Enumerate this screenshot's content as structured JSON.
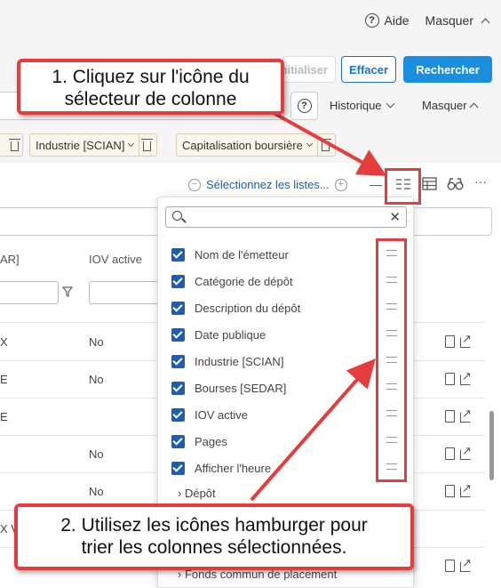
{
  "header": {
    "help_label": "Aide",
    "hide_label": "Masquer"
  },
  "actions": {
    "reset_label": "Réinitialiser",
    "clear_label": "Effacer",
    "search_label": "Rechercher"
  },
  "row2": {
    "history_label": "Historique",
    "hide_label": "Masquer"
  },
  "filters": [
    {
      "label": "Industrie [SCIAN]"
    },
    {
      "label": "Capitalisation boursière"
    }
  ],
  "toolbar": {
    "select_lists_label": "Sélectionnez les listes..."
  },
  "table": {
    "col_left_header": "AR]",
    "col_iov_header": "IOV active",
    "rows": [
      {
        "left": "X",
        "iov": "No"
      },
      {
        "left": "E",
        "iov": "No"
      },
      {
        "left": "E",
        "iov": ""
      },
      {
        "left": "",
        "iov": "No"
      },
      {
        "left": "",
        "iov": "No"
      },
      {
        "left": "X V",
        "iov": ""
      },
      {
        "left": "",
        "iov": ""
      }
    ]
  },
  "column_picker": {
    "search_placeholder": "",
    "options": [
      {
        "label": "Nom de l'émetteur",
        "checked": true
      },
      {
        "label": "Catégorie de dépôt",
        "checked": true
      },
      {
        "label": "Description du dépôt",
        "checked": true
      },
      {
        "label": "Date publique",
        "checked": true
      },
      {
        "label": "Industrie [SCIAN]",
        "checked": true
      },
      {
        "label": "Bourses [SEDAR]",
        "checked": true
      },
      {
        "label": "IOV active",
        "checked": true
      },
      {
        "label": "Pages",
        "checked": true
      },
      {
        "label": "Afficher l'heure",
        "checked": true
      }
    ],
    "groups": [
      {
        "label": "Dépôt"
      },
      {
        "label": "Fonds commun de placement"
      }
    ]
  },
  "annotations": {
    "callout1": [
      "1. Cliquez sur l'icône du",
      "sélecteur de colonne"
    ],
    "callout2": [
      "2. Utilisez les icônes hamburger pour",
      "trier les colonnes sélectionnées."
    ],
    "accent_color": "#e53d3d"
  }
}
